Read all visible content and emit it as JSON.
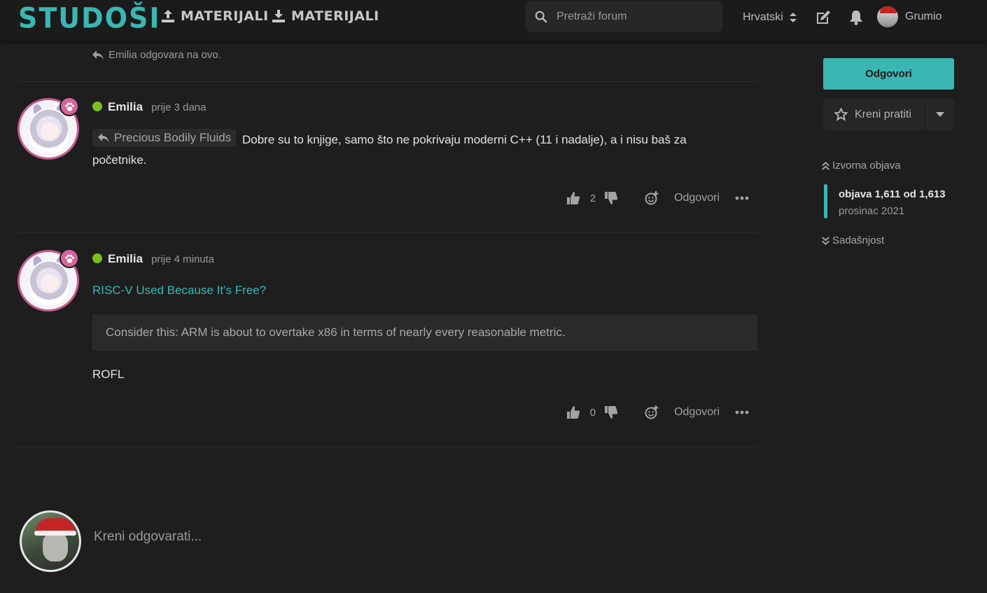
{
  "header": {
    "logo": "STUDOŠI",
    "nav": [
      {
        "label": "MATERIJALI",
        "icon": "upload-icon"
      },
      {
        "label": "MATERIJALI",
        "icon": "download-icon"
      }
    ],
    "search_placeholder": "Pretraži forum",
    "language": "Hrvatski",
    "username": "Grumio"
  },
  "timeline": {
    "reply_note": "Emilia odgovara na ovo."
  },
  "posts": [
    {
      "author": "Emilia",
      "time": "prije 3 dana",
      "reply_to": "Precious Bodily Fluids",
      "text_line1": "Dobre su to knjige, samo što ne pokrivaju moderni C++ (11 i nadalje), a i nisu baš za",
      "text_line2": "početnike.",
      "votes": "2",
      "reply_label": "Odgovori"
    },
    {
      "author": "Emilia",
      "time": "prije 4 minuta",
      "link_title": "RISC-V Used Because It’s Free?",
      "quote": "Consider this: ARM is about to overtake x86 in terms of nearly every reasonable metric.",
      "text": "ROFL",
      "votes": "0",
      "reply_label": "Odgovori"
    }
  ],
  "composer": {
    "placeholder": "Kreni odgovarati..."
  },
  "sidebar": {
    "reply_button": "Odgovori",
    "follow_button": "Kreni pratiti",
    "origin_link": "Izvorna objava",
    "position": "objava 1,611 od 1,613",
    "date": "prosinac 2021",
    "now_link": "Sadašnjost"
  },
  "colors": {
    "accent": "#3ab7b2",
    "background": "#1e1e1e",
    "online": "#7ac01b",
    "avatar_ring": "#c85a8d"
  }
}
